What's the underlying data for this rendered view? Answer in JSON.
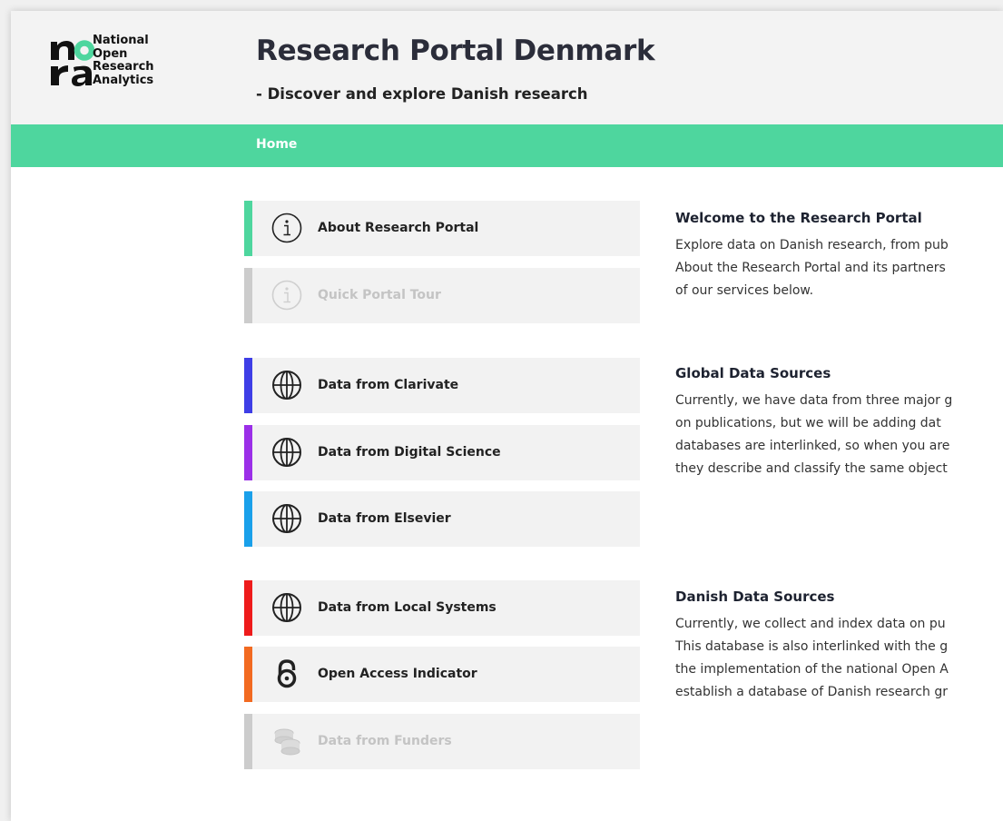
{
  "logo": {
    "name_lines": [
      "National",
      "Open",
      "Research",
      "Analytics"
    ],
    "wordmark": "nora",
    "accent_color": "#4ed69e"
  },
  "header": {
    "title": "Research Portal Denmark",
    "subtitle": "- Discover and explore Danish research"
  },
  "nav": {
    "home_label": "Home",
    "bar_color": "#4ed69e"
  },
  "menu": {
    "about": {
      "label": "About Research Portal",
      "icon": "info-icon",
      "color": "#4ed69e"
    },
    "tour": {
      "label": "Quick Portal Tour",
      "icon": "info-icon",
      "color": "#cccccc"
    },
    "clarivate": {
      "label": "Data from Clarivate",
      "icon": "globe-icon",
      "color": "#3e3ee6"
    },
    "digital_science": {
      "label": "Data from Digital Science",
      "icon": "globe-icon",
      "color": "#9b2fe8"
    },
    "elsevier": {
      "label": "Data from Elsevier",
      "icon": "globe-icon",
      "color": "#1aa0ea"
    },
    "local_systems": {
      "label": "Data from Local Systems",
      "icon": "globe-icon",
      "color": "#ee1b1b"
    },
    "open_access": {
      "label": "Open Access Indicator",
      "icon": "open-access-icon",
      "color": "#f26a21"
    },
    "funders": {
      "label": "Data from Funders",
      "icon": "coins-icon",
      "color": "#cccccc"
    }
  },
  "sections": {
    "welcome": {
      "heading": "Welcome to the Research Portal",
      "lines": [
        "Explore data on Danish research, from pub",
        "About the Research Portal and its partners",
        "of our services below."
      ]
    },
    "global": {
      "heading": "Global Data Sources",
      "lines": [
        "Currently, we have data from three major g",
        "on publications, but we will be adding dat",
        "databases are interlinked, so when you are",
        "they describe and classify the same object"
      ]
    },
    "danish": {
      "heading": "Danish Data Sources",
      "lines": [
        "Currently, we collect and index data on pu",
        "This database is also interlinked with the g",
        "the implementation of the national Open A",
        "establish a database of Danish research gr"
      ]
    }
  }
}
